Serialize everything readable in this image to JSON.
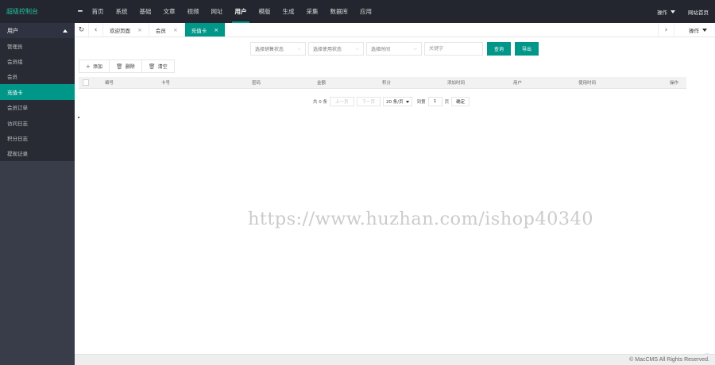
{
  "colors": {
    "accent": "#009688",
    "header_bg": "#23262e",
    "sidebar_bg": "#393d49",
    "logo_text": "#1fc4a0"
  },
  "header": {
    "logo": "超级控制台",
    "fold_icon": "menu-fold-icon",
    "nav": [
      "首页",
      "系统",
      "基础",
      "文章",
      "视频",
      "网址",
      "用户",
      "模版",
      "生成",
      "采集",
      "数据库",
      "应用"
    ],
    "active_nav": "用户",
    "right": {
      "operate": "操作",
      "site_home": "网站首页"
    }
  },
  "sidebar": {
    "section": "用户",
    "items": [
      "管理员",
      "会员组",
      "会员",
      "充值卡",
      "会员订单",
      "访问日志",
      "积分日志",
      "提现记录"
    ],
    "active": "充值卡"
  },
  "tabbar": {
    "tabs": [
      {
        "label": "欢迎页面",
        "close": "×"
      },
      {
        "label": "会员",
        "close": "×"
      },
      {
        "label": "充值卡",
        "close": "×"
      }
    ],
    "operate": "操作"
  },
  "filters": {
    "sale_status": "选择销售状态",
    "use_status": "选择使用状态",
    "time": "选择时间",
    "keyword_placeholder": "关键字",
    "search": "查询",
    "export": "导出"
  },
  "toolbar": {
    "add": "添加",
    "delete": "删除",
    "clear": "清空"
  },
  "table": {
    "columns": [
      "编号",
      "卡号",
      "密码",
      "金额",
      "积分",
      "添加时间",
      "用户",
      "使用时间",
      "操作"
    ]
  },
  "pager": {
    "total": "共 0 条",
    "prev": "上一页",
    "next": "下一页",
    "per_page": "20 条/页",
    "goto": "到第",
    "page_value": "1",
    "page_unit": "页",
    "confirm": "确定"
  },
  "watermark": "https://www.huzhan.com/ishop40340",
  "footer": "© MacCMS All Rights Reserved."
}
